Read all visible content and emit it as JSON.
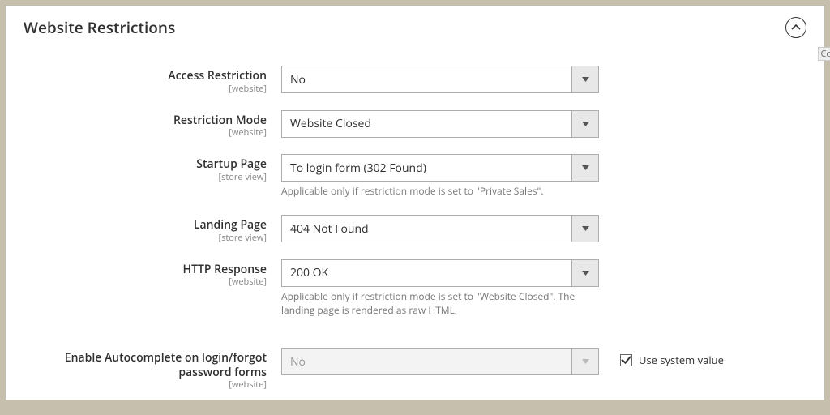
{
  "panel": {
    "title": "Website Restrictions"
  },
  "outside": {
    "fragment": "Co"
  },
  "fields": {
    "access": {
      "label": "Access Restriction",
      "scope": "[website]",
      "value": "No"
    },
    "mode": {
      "label": "Restriction Mode",
      "scope": "[website]",
      "value": "Website Closed"
    },
    "startup": {
      "label": "Startup Page",
      "scope": "[store view]",
      "value": "To login form (302 Found)",
      "hint": "Applicable only if restriction mode is set to \"Private Sales\"."
    },
    "landing": {
      "label": "Landing Page",
      "scope": "[store view]",
      "value": "404 Not Found"
    },
    "http": {
      "label": "HTTP Response",
      "scope": "[website]",
      "value": "200 OK",
      "hint": "Applicable only if restriction mode is set to \"Website Closed\". The landing page is rendered as raw HTML."
    },
    "autocomplete": {
      "label": "Enable Autocomplete on login/forgot password forms",
      "scope": "[website]",
      "value": "No",
      "use_system_label": "Use system value"
    }
  }
}
